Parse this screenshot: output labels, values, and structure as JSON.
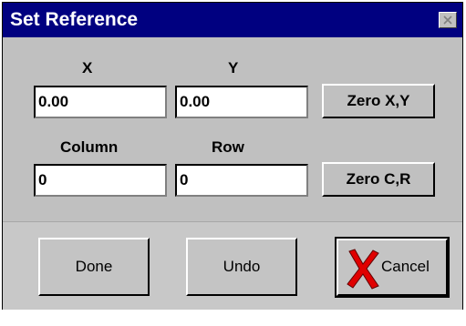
{
  "window": {
    "title": "Set Reference"
  },
  "labels": {
    "x": "X",
    "y": "Y",
    "column": "Column",
    "row": "Row"
  },
  "fields": {
    "x_value": "0.00",
    "y_value": "0.00",
    "column_value": "0",
    "row_value": "0"
  },
  "buttons": {
    "zero_xy": "Zero X,Y",
    "zero_cr": "Zero C,R",
    "done": "Done",
    "undo": "Undo",
    "cancel": "Cancel"
  },
  "icons": {
    "close": "close-icon",
    "cancel": "red-x-icon"
  },
  "colors": {
    "titlebar": "#000080",
    "dialog": "#c0c0c0",
    "cancel_x": "#e00000"
  }
}
